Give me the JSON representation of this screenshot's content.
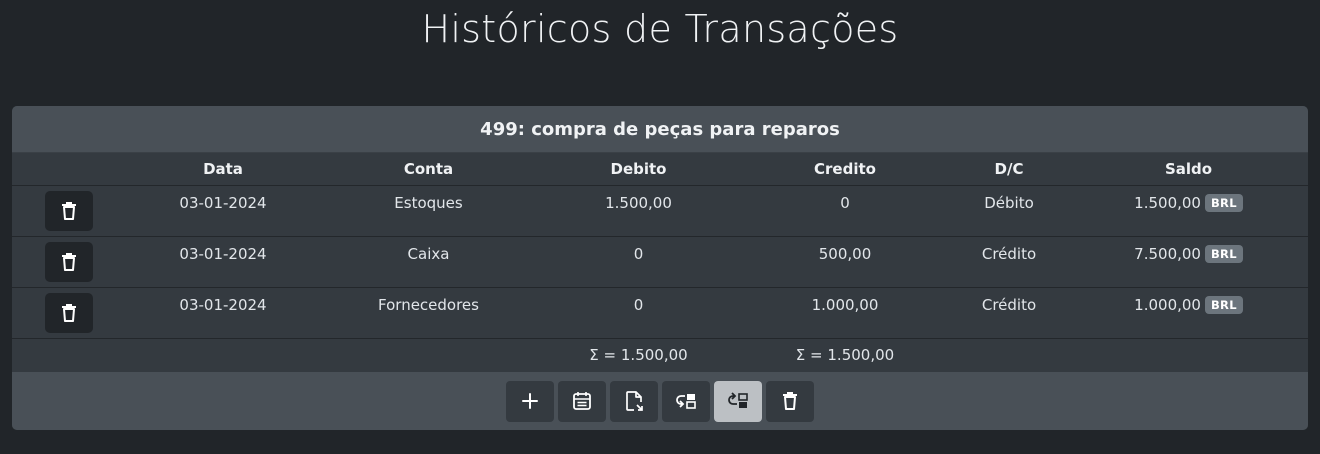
{
  "page": {
    "title": "Históricos de Transações"
  },
  "transaction": {
    "header": "499: compra de peças para reparos"
  },
  "table": {
    "columns": [
      "",
      "Data",
      "Conta",
      "Debito",
      "Credito",
      "D/C",
      "Saldo"
    ],
    "rows": [
      {
        "date": "03-01-2024",
        "account": "Estoques",
        "debit": "1.500,00",
        "credit": "0",
        "dc": "Débito",
        "balance": "1.500,00",
        "currency": "BRL"
      },
      {
        "date": "03-01-2024",
        "account": "Caixa",
        "debit": "0",
        "credit": "500,00",
        "dc": "Crédito",
        "balance": "7.500,00",
        "currency": "BRL"
      },
      {
        "date": "03-01-2024",
        "account": "Fornecedores",
        "debit": "0",
        "credit": "1.000,00",
        "dc": "Crédito",
        "balance": "1.000,00",
        "currency": "BRL"
      }
    ],
    "totals": {
      "debit": "Σ = 1.500,00",
      "credit": "Σ = 1.500,00"
    }
  },
  "icons": {
    "row_delete": "trash-icon",
    "toolbar": [
      "plus-icon",
      "calendar-icon",
      "file-export-icon",
      "swap-left-icon",
      "swap-right-icon",
      "trash-icon"
    ]
  },
  "colors": {
    "background": "#212529",
    "card": "#343a40",
    "header": "#495057",
    "badge": "#6c757d",
    "active_button": "#bcc0c4"
  }
}
